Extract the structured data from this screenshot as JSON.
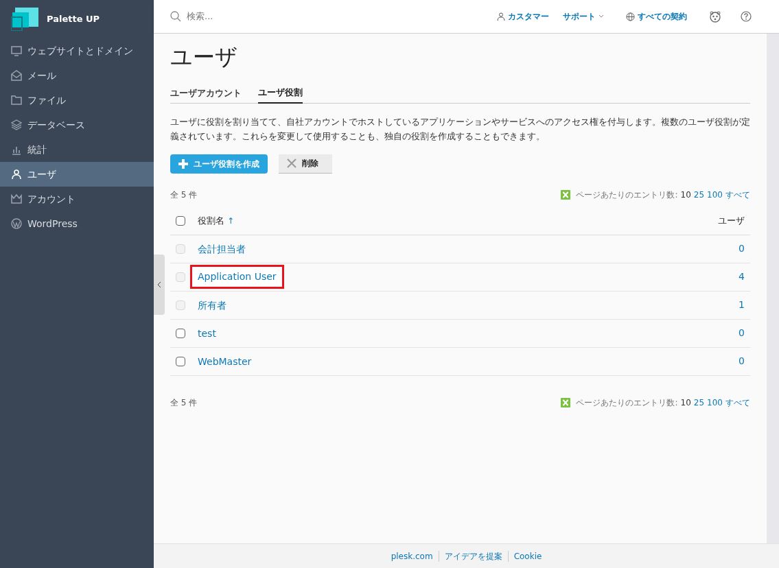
{
  "brand": "Palette UP",
  "sidebar": {
    "items": [
      {
        "label": "ウェブサイトとドメイン",
        "selected": false
      },
      {
        "label": "メール",
        "selected": false
      },
      {
        "label": "ファイル",
        "selected": false
      },
      {
        "label": "データベース",
        "selected": false
      },
      {
        "label": "統計",
        "selected": false
      },
      {
        "label": "ユーザ",
        "selected": true
      },
      {
        "label": "アカウント",
        "selected": false
      },
      {
        "label": "WordPress",
        "selected": false
      }
    ]
  },
  "header": {
    "search": {
      "placeholder": "検索..."
    },
    "customer": "カスタマー",
    "support": "サポート",
    "subscriptions": "すべての契約"
  },
  "page": {
    "title": "ユーザ",
    "tabs": [
      {
        "label": "ユーザアカウント",
        "selected": false
      },
      {
        "label": "ユーザ役割",
        "selected": true
      }
    ],
    "description": "ユーザに役割を割り当てて、自社アカウントでホストしているアプリケーションやサービスへのアクセス権を付与します。複数のユーザ役割が定義されています。これらを変更して使用することも、独自の役割を作成することもできます。",
    "buttons": {
      "create": "ユーザ役割を作成",
      "delete": "削除"
    },
    "pager_top": {
      "total": "全 5 件",
      "per_page_label": "ページあたりのエントリ数:",
      "per_page": [
        {
          "label": "10",
          "selected": true
        },
        {
          "label": "25",
          "selected": false
        },
        {
          "label": "100",
          "selected": false
        },
        {
          "label": "すべて",
          "selected": false
        }
      ]
    },
    "table": {
      "select_all_checked": false,
      "columns": [
        "役割名",
        "ユーザ"
      ],
      "sort_mark": "↑",
      "rows": [
        {
          "name": "会計担当者",
          "users": "0",
          "disabled": true,
          "highlighted": false
        },
        {
          "name": "Application User",
          "users": "4",
          "disabled": true,
          "highlighted": true
        },
        {
          "name": "所有者",
          "users": "1",
          "disabled": true,
          "highlighted": false
        },
        {
          "name": "test",
          "users": "0",
          "disabled": false,
          "highlighted": false
        },
        {
          "name": "WebMaster",
          "users": "0",
          "disabled": false,
          "highlighted": false
        }
      ]
    },
    "pager_bottom": {
      "total": "全 5 件",
      "per_page_label": "ページあたりのエントリ数:",
      "per_page": [
        {
          "label": "10",
          "selected": true
        },
        {
          "label": "25",
          "selected": false
        },
        {
          "label": "100",
          "selected": false
        },
        {
          "label": "すべて",
          "selected": false
        }
      ]
    }
  },
  "footer": [
    "plesk.com",
    "アイデアを提案",
    "Cookie"
  ]
}
